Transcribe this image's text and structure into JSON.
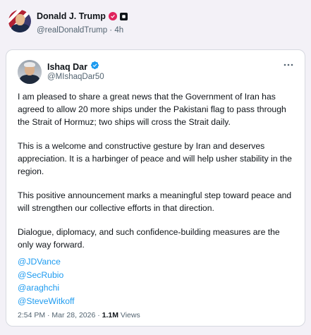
{
  "post": {
    "author_name": "Donald J. Trump",
    "author_handle": "@realDonaldTrump",
    "separator": "·",
    "time_ago": "4h"
  },
  "quoted": {
    "author_name": "Ishaq Dar",
    "author_handle": "@MIshaqDar50",
    "more_label": "···",
    "paragraphs": [
      "I am pleased to share a great news that the Government of Iran has agreed to allow 20 more ships under the Pakistani flag to pass through the Strait of Hormuz; two ships will cross the Strait daily.",
      "This is a welcome and constructive gesture by Iran and deserves appreciation. It is a harbinger of peace and will help usher stability in the region.",
      "This positive announcement marks a meaningful step toward peace and will strengthen our collective efforts in that direction.",
      "Dialogue, diplomacy, and such confidence-building measures are the only way forward."
    ],
    "mentions": [
      "@JDVance",
      "@SecRubio",
      "@araghchi",
      "@SteveWitkoff"
    ],
    "timestamp": "2:54 PM · Mar 28, 2026 · ",
    "views_count": "1.1M",
    "views_label": " Views"
  },
  "colors": {
    "background": "#f3f1f7",
    "link": "#1d9bf0",
    "verified": "#1d9bf0",
    "gov_badge": "#e0245e",
    "secondary_text": "#536471"
  }
}
